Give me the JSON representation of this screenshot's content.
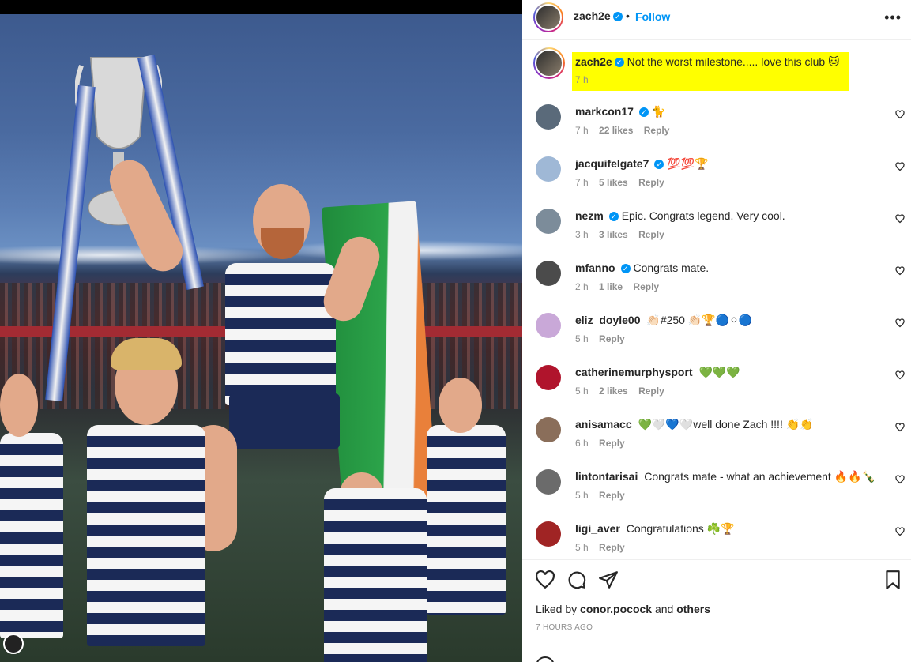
{
  "post": {
    "username": "zach2e",
    "verified_mark": "✓",
    "separator": "•",
    "follow_label": "Follow",
    "more_label": "•••",
    "caption_text": "Not the worst milestone..... love this club 🐱",
    "caption_time": "7 h"
  },
  "comments": [
    {
      "user": "markcon17",
      "verified": true,
      "text": "🐈",
      "time": "7 h",
      "likes": "22 likes",
      "reply": "Reply",
      "avatar_color": "#5a6a7a"
    },
    {
      "user": "jacquifelgate7",
      "verified": true,
      "text": "💯💯🏆",
      "time": "7 h",
      "likes": "5 likes",
      "reply": "Reply",
      "avatar_color": "#9fb8d6"
    },
    {
      "user": "nezm",
      "verified": true,
      "text": "Epic. Congrats legend. Very cool.",
      "time": "3 h",
      "likes": "3 likes",
      "reply": "Reply",
      "avatar_color": "#7c8c9a"
    },
    {
      "user": "mfanno",
      "verified": true,
      "text": "Congrats mate.",
      "time": "2 h",
      "likes": "1 like",
      "reply": "Reply",
      "avatar_color": "#4b4b4b"
    },
    {
      "user": "eliz_doyle00",
      "verified": false,
      "text": "👏🏻#250 👏🏻🏆🔵⚪🔵",
      "time": "5 h",
      "likes": "",
      "reply": "Reply",
      "avatar_color": "#c9a8d8"
    },
    {
      "user": "catherinemurphysport",
      "verified": false,
      "text": "💚💚💚",
      "time": "5 h",
      "likes": "2 likes",
      "reply": "Reply",
      "avatar_color": "#b0142c"
    },
    {
      "user": "anisamacc",
      "verified": false,
      "text": "💚🤍💙🤍well done Zach !!!! 👏👏",
      "time": "6 h",
      "likes": "",
      "reply": "Reply",
      "avatar_color": "#8a6e5a"
    },
    {
      "user": "lintontarisai",
      "verified": false,
      "text": "Congrats mate - what an achievement 🔥🔥🍾🍾",
      "time": "5 h",
      "likes": "",
      "reply": "Reply",
      "avatar_color": "#6b6b6b"
    },
    {
      "user": "ligi_aver",
      "verified": false,
      "text": "Congratulations ☘️🏆",
      "time": "5 h",
      "likes": "",
      "reply": "Reply",
      "avatar_color": "#a02424"
    }
  ],
  "footer": {
    "liked_by_prefix": "Liked by",
    "liked_by_user": "conor.pocock",
    "liked_by_and": "and",
    "liked_by_others": "others",
    "time_ago": "7 HOURS AGO"
  },
  "colors": {
    "accent": "#0095f6",
    "caption_highlight": "#ffff00"
  }
}
